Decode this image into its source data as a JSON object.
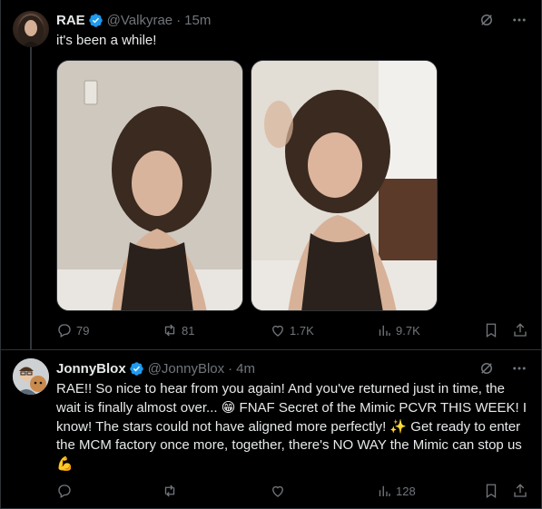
{
  "tweet1": {
    "name": "RAE",
    "handle": "@Valkyrae",
    "separator": "·",
    "time": "15m",
    "text": "it's been a while!",
    "actions": {
      "replies": "79",
      "reposts": "81",
      "likes": "1.7K",
      "views": "9.7K"
    }
  },
  "tweet2": {
    "name": "JonnyBlox",
    "handle": "@JonnyBlox",
    "separator": "·",
    "time": "4m",
    "text_part1": "RAE!! So nice to hear from you again! And you've returned just in time, the wait is finally almost over... ",
    "emoji1": "😁",
    "text_part2": " FNAF Secret of the Mimic PCVR THIS WEEK! I know! The stars could not have aligned more perfectly! ",
    "emoji2": "✨",
    "text_part3": " Get ready to enter the MCM factory once more, together, there's NO WAY the Mimic can stop us ",
    "emoji3": "💪",
    "actions": {
      "replies": "",
      "reposts": "",
      "likes": "",
      "views": "128"
    }
  },
  "colors": {
    "background": "#000000",
    "text": "#e7e9ea",
    "secondary": "#71767b",
    "verified": "#1d9bf0",
    "border": "#2f3336"
  },
  "icons": [
    "grok-icon",
    "more-icon",
    "reply-icon",
    "repost-icon",
    "like-icon",
    "views-icon",
    "bookmark-icon",
    "share-icon",
    "verified-badge-icon"
  ]
}
